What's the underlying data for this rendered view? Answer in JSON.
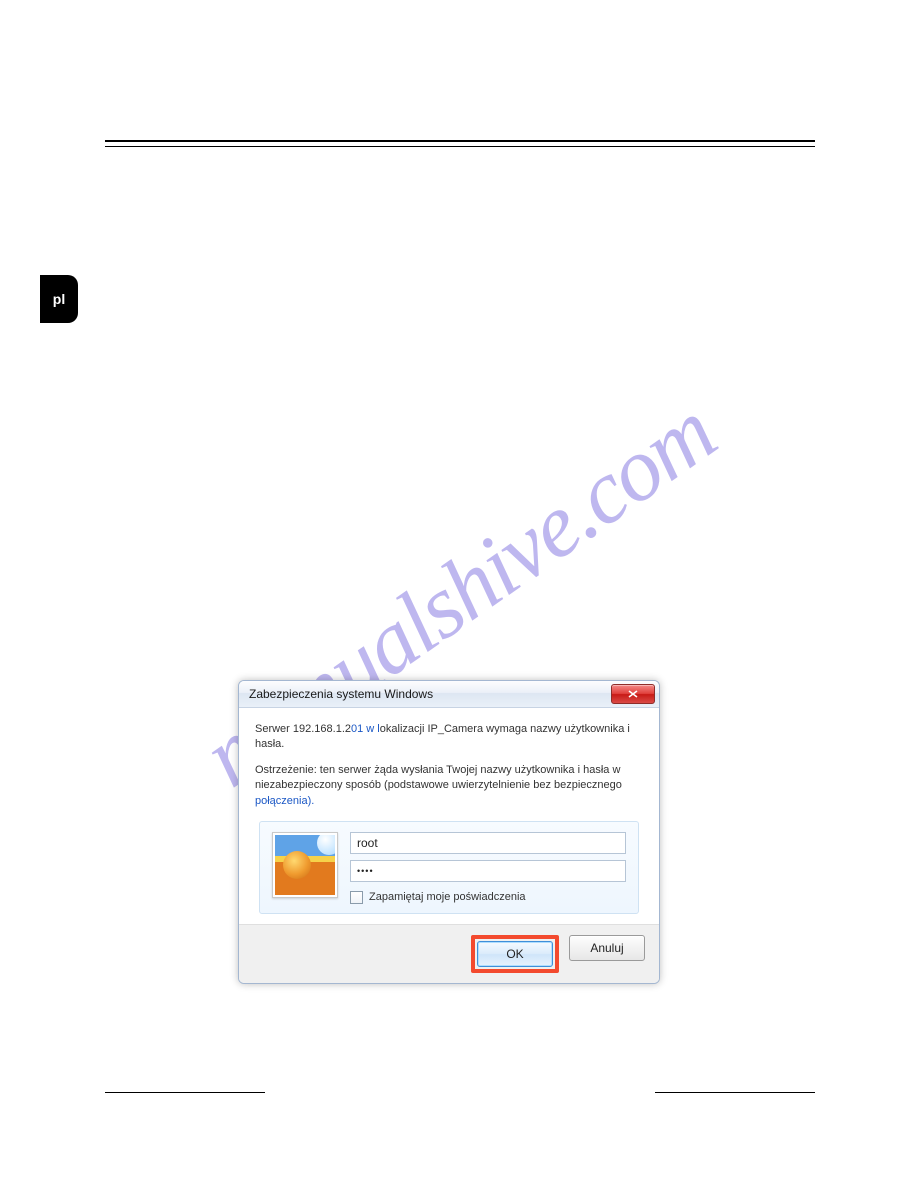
{
  "page": {
    "side_tab": "pl",
    "watermark": "manualshive.com"
  },
  "dialog": {
    "title": "Zabezpieczenia systemu Windows",
    "msg1_pre": "Serwer 192.168.1.2",
    "msg1_link": "01 w l",
    "msg1_post": "okalizacji IP_Camera wymaga nazwy użytkownika i hasła.",
    "msg2_pre": "Ostrzeżenie: ten serwer żąda wysłania Twojej nazwy użytkownika i hasła w niezabezpieczony sposób (podstawowe uwierzytelnienie bez bezpiecznego ",
    "msg2_link": "połączenia).",
    "username": "root",
    "password": "••••",
    "remember": "Zapamiętaj moje poświadczenia",
    "ok": "OK",
    "cancel": "Anuluj"
  }
}
